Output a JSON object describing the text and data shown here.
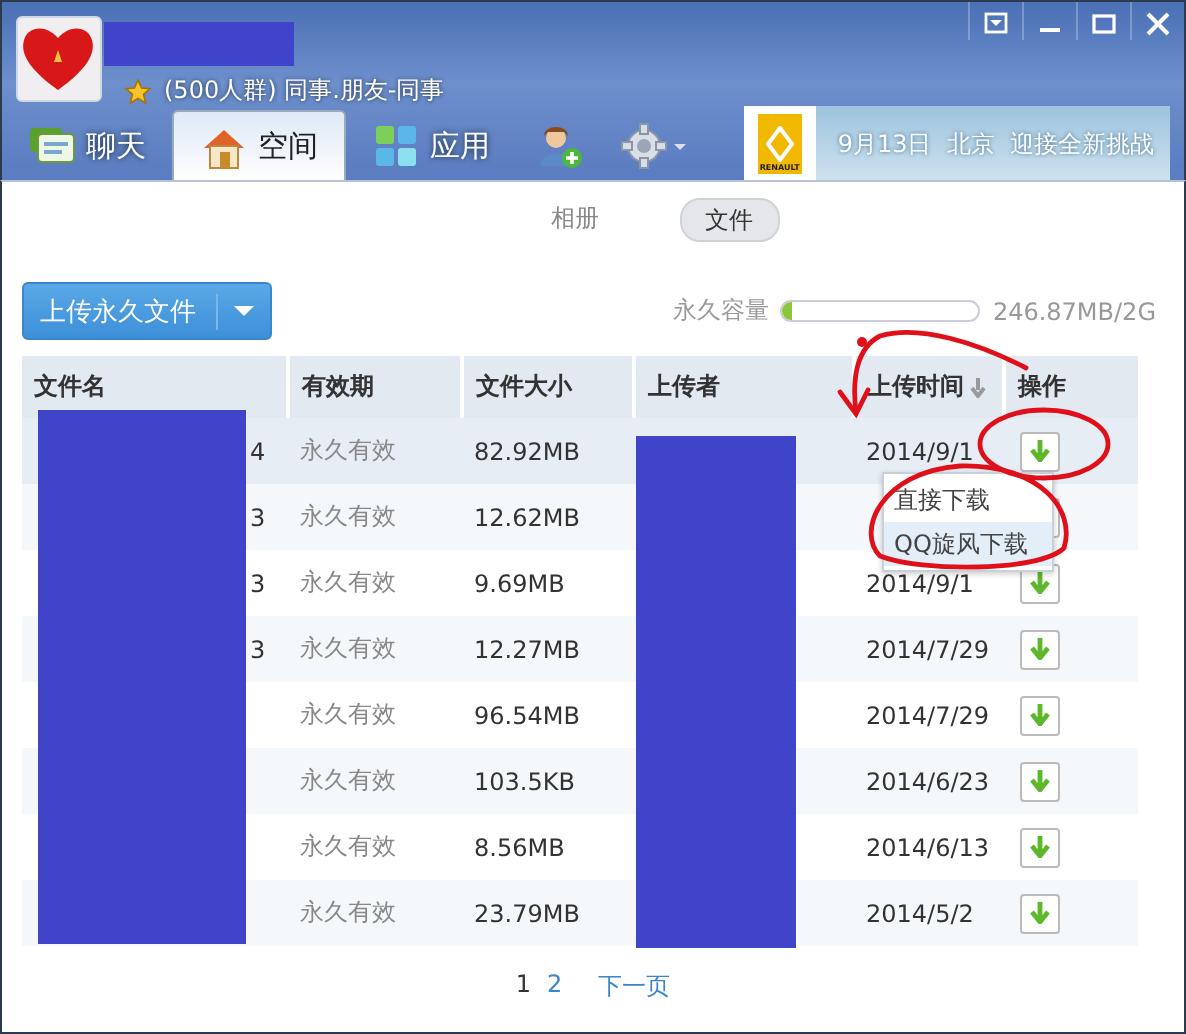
{
  "group": {
    "name": "(500人群) 同事.朋友-同事"
  },
  "tabs": [
    {
      "label": "聊天",
      "selected": false
    },
    {
      "label": "空间",
      "selected": true
    },
    {
      "label": "应用",
      "selected": false
    }
  ],
  "banner": {
    "logo_text": "RENAULT",
    "text": "9月13日  北京  迎接全新挑战"
  },
  "subtabs": [
    {
      "label": "相册",
      "selected": false
    },
    {
      "label": "文件",
      "selected": true
    }
  ],
  "upload_button": {
    "label": "上传永久文件"
  },
  "capacity": {
    "label": "永久容量",
    "level": 0.05,
    "reading": "246.87MB/2G"
  },
  "table": {
    "columns": [
      "文件名",
      "有效期",
      "文件大小",
      "上传者",
      "上传时间",
      "操作"
    ],
    "rows": [
      {
        "name": "4",
        "validity": "永久有效",
        "size": "82.92MB",
        "date": "2014/9/1",
        "selected": true
      },
      {
        "name": "3",
        "validity": "永久有效",
        "size": "12.62MB",
        "selected": false
      },
      {
        "name": "3",
        "validity": "永久有效",
        "size": "9.69MB",
        "date": "2014/9/1",
        "selected": false
      },
      {
        "name": "3",
        "validity": "永久有效",
        "size": "12.27MB",
        "date": "2014/7/29",
        "selected": false
      },
      {
        "validity": "永久有效",
        "size": "96.54MB",
        "date": "2014/7/29",
        "selected": false
      },
      {
        "validity": "永久有效",
        "size": "103.5KB",
        "date": "2014/6/23",
        "selected": false
      },
      {
        "validity": "永久有效",
        "size": "8.56MB",
        "date": "2014/6/13",
        "selected": false
      },
      {
        "validity": "永久有效",
        "size": "23.79MB",
        "date": "2014/5/2",
        "selected": false
      }
    ]
  },
  "dropdown": {
    "items": [
      {
        "label": "直接下载",
        "selected": false
      },
      {
        "label": "QQ旋风下载",
        "selected": true
      }
    ]
  },
  "pagination": {
    "pages": [
      {
        "label": "1",
        "selected": true
      },
      {
        "label": "2",
        "selected": false
      }
    ],
    "next": "下一页"
  }
}
